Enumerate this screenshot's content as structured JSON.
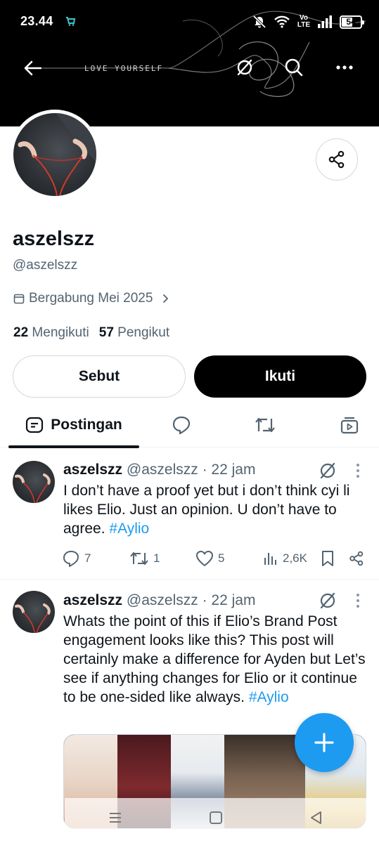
{
  "status_bar": {
    "time": "23.44",
    "volte": "Vo\nLTE",
    "battery": "54"
  },
  "header": {
    "banner_title": "LOVE YOURSELF"
  },
  "profile": {
    "display_name": "aszelszz",
    "handle": "@aszelszz",
    "joined": "Bergabung Mei 2025",
    "following_count": "22",
    "following_label": "Mengikuti",
    "followers_count": "57",
    "followers_label": "Pengikut",
    "mention_label": "Sebut",
    "follow_label": "Ikuti"
  },
  "tabs": {
    "posts_label": "Postingan"
  },
  "posts": [
    {
      "name": "aszelszz",
      "handle": "@aszelszz",
      "time": "· 22 jam",
      "text": "I don’t have a proof yet but i don’t think cyi li likes Elio. Just an opinion. U don’t have to agree. ",
      "hashtag": "#Aylio",
      "replies": "7",
      "reposts": "1",
      "likes": "5",
      "views": "2,6K"
    },
    {
      "name": "aszelszz",
      "handle": "@aszelszz",
      "time": "· 22 jam",
      "text": "Whats the point of this if Elio’s Brand Post engagement looks like this? This post will certainly make a difference for Ayden but Let’s see if anything changes for Elio or it continue to be one-sided like always. ",
      "hashtag": "#Aylio"
    }
  ],
  "colors": {
    "accent": "#1d9bf0",
    "text": "#0f1419",
    "secondary": "#536471",
    "border": "#cfd9de"
  },
  "icons": [
    "back-arrow-icon",
    "grok-icon",
    "search-icon",
    "more-icon",
    "share-icon",
    "calendar-icon",
    "chevron-right-icon",
    "posts-tab-icon",
    "replies-tab-icon",
    "reposts-tab-icon",
    "media-tab-icon",
    "reply-icon",
    "repost-icon",
    "like-icon",
    "views-icon",
    "bookmark-icon",
    "plus-icon"
  ]
}
